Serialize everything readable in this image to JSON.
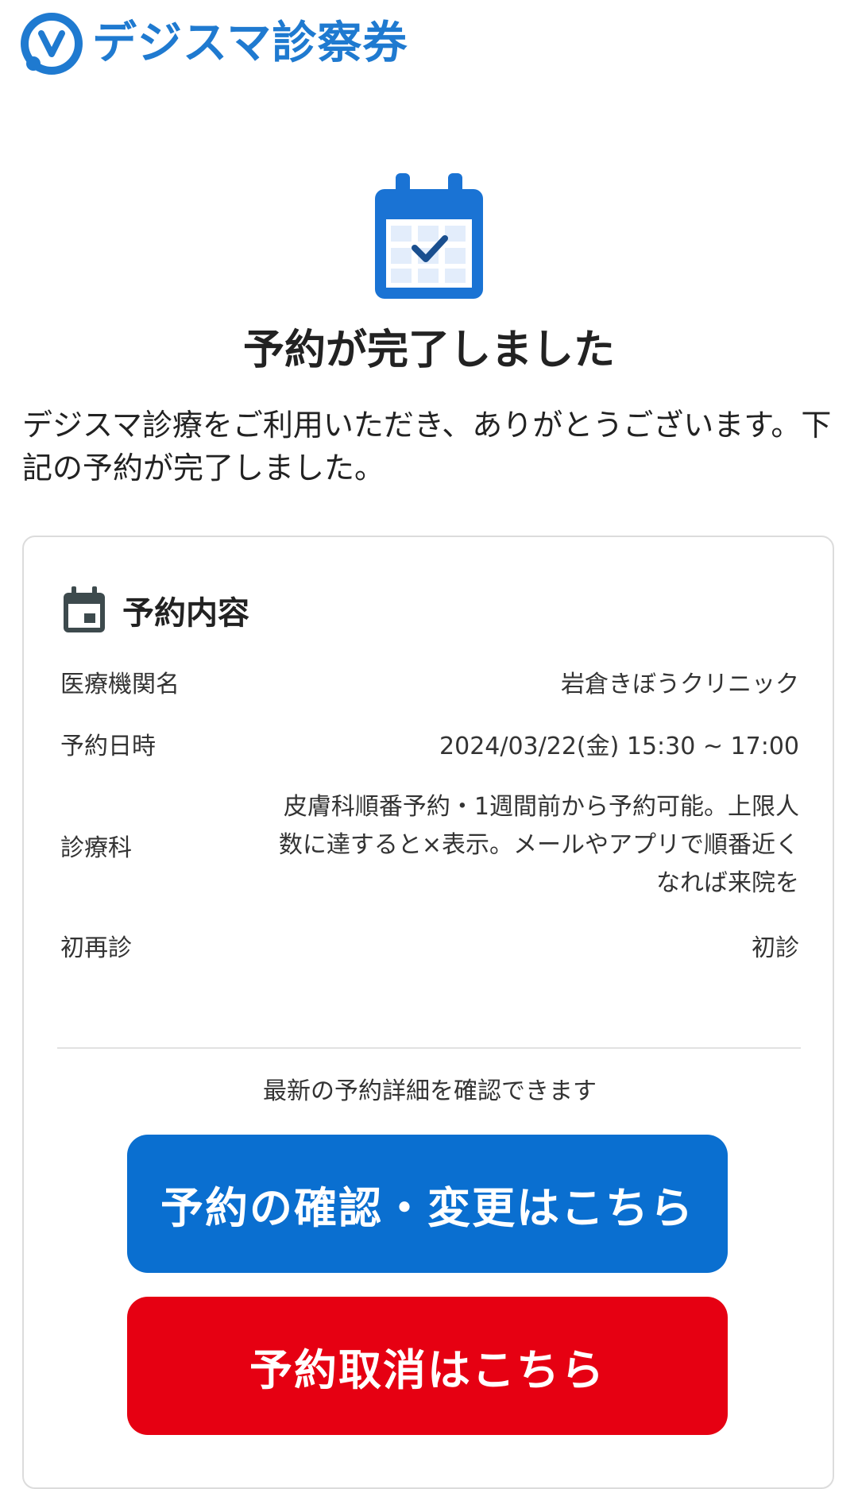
{
  "header": {
    "logo_text": "デジスマ診察券"
  },
  "hero": {
    "title": "予約が完了しました"
  },
  "intro": {
    "text": "デジスマ診療をご利用いただき、ありがとうございます。下記の予約が完了しました。"
  },
  "card": {
    "title": "予約内容",
    "rows": [
      {
        "label": "医療機関名",
        "value": "岩倉きぼうクリニック"
      },
      {
        "label": "予約日時",
        "value": "2024/03/22(金) 15:30 ~ 17:00"
      },
      {
        "label": "診療科",
        "value": "皮膚科順番予約・1週間前から予約可能。上限人数に達すると×表示。メールやアプリで順番近くなれば来院を"
      },
      {
        "label": "初再診",
        "value": "初診"
      }
    ],
    "note": "最新の予約詳細を確認できます",
    "confirm_button": "予約の確認・変更はこちら",
    "cancel_button": "予約取消はこちら"
  },
  "colors": {
    "brand": "#1f7ad0",
    "primary": "#0a6fd0",
    "danger": "#e60012"
  }
}
